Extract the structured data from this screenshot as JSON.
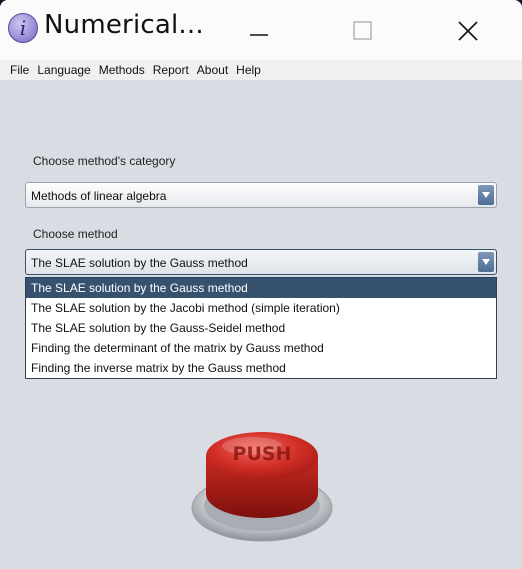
{
  "window": {
    "title": "Numerical..."
  },
  "menu": {
    "items": [
      "File",
      "Language",
      "Methods",
      "Report",
      "About",
      "Help"
    ]
  },
  "category": {
    "label": "Choose method's category",
    "selected": "Methods of linear algebra"
  },
  "method": {
    "label": "Choose method",
    "selected": "The SLAE solution by the Gauss method",
    "options": [
      "The SLAE solution by the Gauss method",
      "The SLAE solution by the Jacobi method (simple iteration)",
      "The SLAE solution by the Gauss-Seidel method",
      "Finding the determinant of the matrix by Gauss method",
      "Finding the inverse matrix by the Gauss method"
    ]
  },
  "push_button": {
    "label": "PUSH"
  },
  "colors": {
    "selection": "#36526f",
    "window_bg": "#d9dce3",
    "button_red": "#c0241e"
  }
}
